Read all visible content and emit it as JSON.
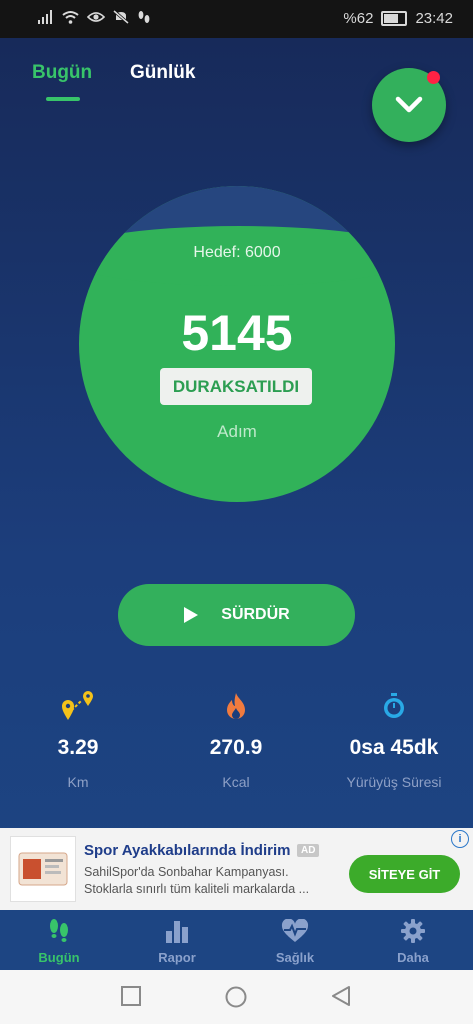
{
  "status_bar": {
    "battery": "%62",
    "time": "23:42"
  },
  "tabs": [
    {
      "label": "Bugün",
      "active": true
    },
    {
      "label": "Günlük",
      "active": false
    }
  ],
  "progress": {
    "goal_label": "Hedef: 6000",
    "steps": "5145",
    "state": "DURAKSATILDI",
    "unit": "Adım"
  },
  "resume_button": {
    "label": "SÜRDÜR"
  },
  "stats": [
    {
      "icon": "route-pin-icon",
      "value": "3.29",
      "label": "Km"
    },
    {
      "icon": "flame-icon",
      "value": "270.9",
      "label": "Kcal"
    },
    {
      "icon": "stopwatch-icon",
      "value": "0sa 45dk",
      "label": "Yürüyüş Süresi"
    }
  ],
  "ad": {
    "title": "Spor Ayakkabılarında İndirim",
    "badge": "AD",
    "description": "SahilSpor'da Sonbahar Kampanyası. Stoklarla sınırlı tüm kaliteli markalarda ...",
    "button": "SİTEYE GİT",
    "info": "i"
  },
  "bottom_nav": [
    {
      "icon": "footsteps-icon",
      "label": "Bugün",
      "active": true
    },
    {
      "icon": "bar-chart-icon",
      "label": "Rapor",
      "active": false
    },
    {
      "icon": "heart-pulse-icon",
      "label": "Sağlık",
      "active": false
    },
    {
      "icon": "gear-icon",
      "label": "Daha",
      "active": false
    }
  ],
  "colors": {
    "accent": "#33b05c",
    "background": "#1a3161",
    "notification": "#ff2244"
  }
}
